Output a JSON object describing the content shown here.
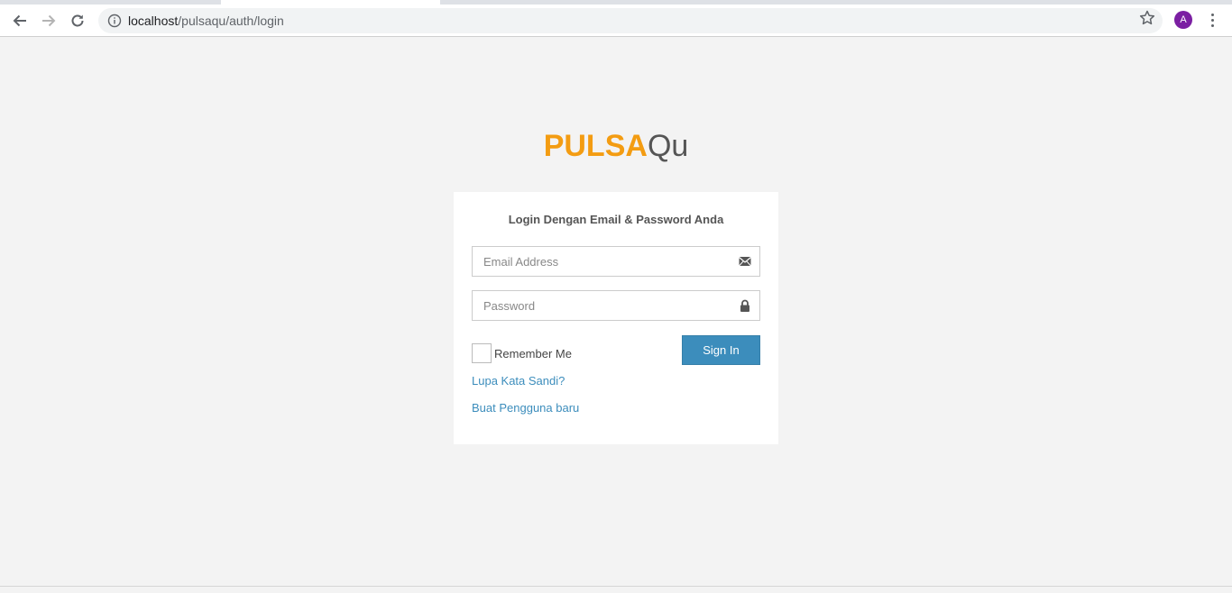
{
  "browser": {
    "url_host": "localhost",
    "url_path": "/pulsaqu/auth/login",
    "avatar_letter": "A",
    "avatar_color": "#7b1fa2"
  },
  "logo": {
    "brand": "PULSA",
    "suffix": "Qu",
    "brand_color": "#f39c12"
  },
  "login": {
    "title": "Login Dengan Email & Password Anda",
    "email_placeholder": "Email Address",
    "password_placeholder": "Password",
    "remember_label": "Remember Me",
    "signin_label": "Sign In",
    "forgot_link": "Lupa Kata Sandi?",
    "register_link": "Buat Pengguna baru",
    "accent_color": "#3c8dbc"
  }
}
